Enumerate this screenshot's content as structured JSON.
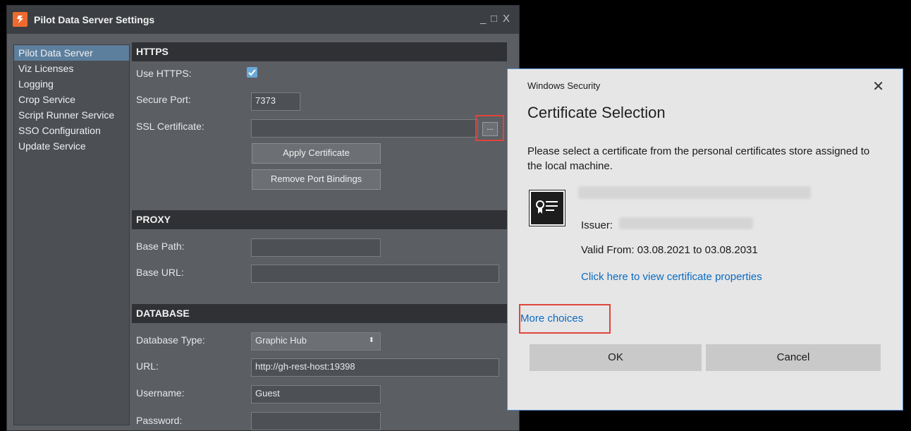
{
  "window": {
    "title": "Pilot Data Server Settings",
    "controls": {
      "minimize": "_",
      "maximize": "□",
      "close": "X"
    }
  },
  "sidebar": {
    "items": [
      {
        "label": "Pilot Data Server",
        "selected": true
      },
      {
        "label": "Viz Licenses"
      },
      {
        "label": "Logging"
      },
      {
        "label": "Crop Service"
      },
      {
        "label": "Script Runner Service"
      },
      {
        "label": "SSO Configuration"
      },
      {
        "label": "Update Service"
      }
    ]
  },
  "https": {
    "header": "HTTPS",
    "use_https_label": "Use HTTPS:",
    "use_https_checked": true,
    "secure_port_label": "Secure Port:",
    "secure_port_value": "7373",
    "ssl_certificate_label": "SSL Certificate:",
    "ssl_certificate_value": "",
    "browse_label": "...",
    "apply_certificate_label": "Apply Certificate",
    "remove_port_bindings_label": "Remove Port Bindings"
  },
  "proxy": {
    "header": "PROXY",
    "base_path_label": "Base Path:",
    "base_path_value": "",
    "base_url_label": "Base URL:",
    "base_url_value": ""
  },
  "database": {
    "header": "DATABASE",
    "type_label": "Database Type:",
    "type_value": "Graphic Hub",
    "url_label": "URL:",
    "url_value": "http://gh-rest-host:19398",
    "username_label": "Username:",
    "username_value": "Guest",
    "password_label": "Password:",
    "password_value": ""
  },
  "dialog": {
    "window_title": "Windows Security",
    "close_glyph": "✕",
    "heading": "Certificate Selection",
    "description": "Please select a certificate from the personal certificates store assigned to the local machine.",
    "issuer_label": "Issuer:",
    "valid_from": "Valid From: 03.08.2021 to 03.08.2031",
    "view_properties_link": "Click here to view certificate properties",
    "more_choices_link": "More choices",
    "ok_label": "OK",
    "cancel_label": "Cancel"
  },
  "colors": {
    "accent": "#ef6a2e",
    "selection": "#5d7f9e",
    "link": "#0b6bc2",
    "highlight": "#e2443a",
    "checkbox": "#6aa7d6"
  }
}
